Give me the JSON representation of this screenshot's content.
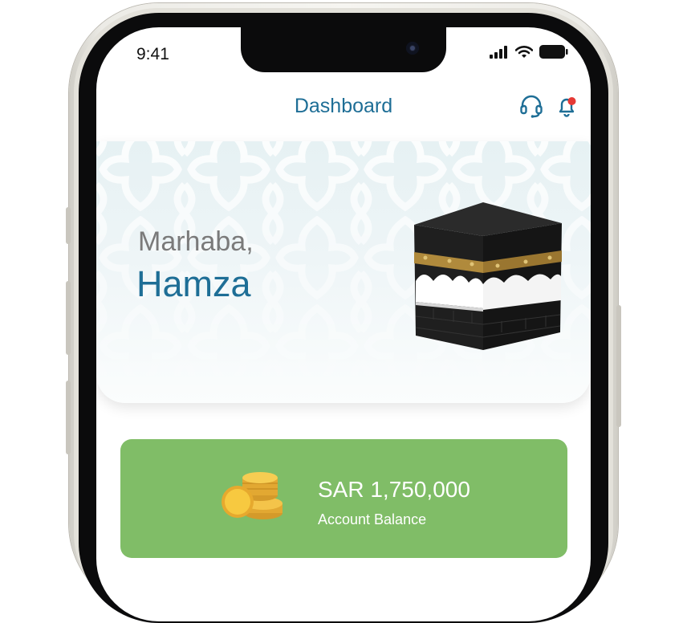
{
  "status_bar": {
    "time": "9:41"
  },
  "header": {
    "title": "Dashboard"
  },
  "hero": {
    "greeting": "Marhaba,",
    "user_name": "Hamza"
  },
  "balance": {
    "amount": "SAR 1,750,000",
    "label": "Account Balance"
  },
  "icons": {
    "support": "headset-icon",
    "notifications": "bell-icon",
    "notification_badge_color": "#e53935",
    "kaaba": "kaaba-illustration",
    "coins": "coins-icon"
  },
  "colors": {
    "primary": "#1e6e96",
    "card": "#80bd67",
    "text_muted": "#7a7a7a"
  }
}
